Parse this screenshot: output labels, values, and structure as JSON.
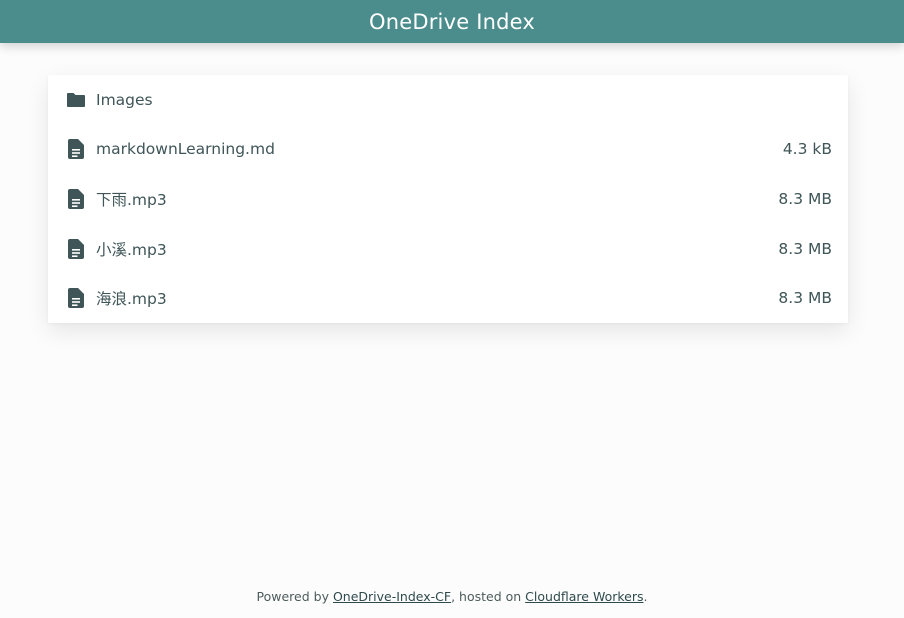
{
  "header": {
    "title": "OneDrive Index"
  },
  "files": [
    {
      "icon": "folder-icon",
      "name": "Images",
      "size": ""
    },
    {
      "icon": "file-icon",
      "name": "markdownLearning.md",
      "size": "4.3 kB"
    },
    {
      "icon": "file-icon",
      "name": "下雨.mp3",
      "size": "8.3 MB"
    },
    {
      "icon": "file-icon",
      "name": "小溪.mp3",
      "size": "8.3 MB"
    },
    {
      "icon": "file-icon",
      "name": "海浪.mp3",
      "size": "8.3 MB"
    }
  ],
  "footer": {
    "prefix": "Powered by ",
    "link1": "OneDrive-Index-CF",
    "middle": ", hosted on ",
    "link2": "Cloudflare Workers",
    "suffix": "."
  },
  "colors": {
    "header_bg": "#4b8d8c",
    "icon": "#3f5557",
    "page_bg": "#fcfcfc"
  }
}
